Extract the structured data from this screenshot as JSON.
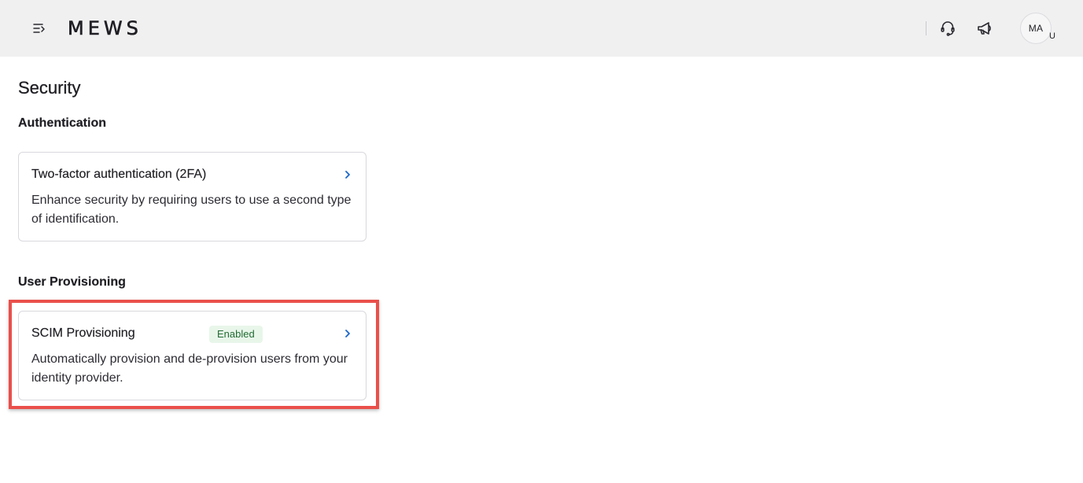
{
  "header": {
    "logo_text": "MEWS",
    "menu_icon": "menu-collapse-icon",
    "support_icon": "headset-icon",
    "announcements_icon": "megaphone-icon",
    "avatar": {
      "initials": "MA",
      "badge": "U"
    }
  },
  "page": {
    "title": "Security"
  },
  "sections": [
    {
      "title": "Authentication",
      "cards": [
        {
          "title": "Two-factor authentication (2FA)",
          "description": "Enhance security by requiring users to use a second type of identification.",
          "chevron_icon": "chevron-right-icon"
        }
      ]
    },
    {
      "title": "User Provisioning",
      "cards": [
        {
          "title": "SCIM Provisioning",
          "badge": "Enabled",
          "description": "Automatically provision and de-provision users from your identity provider.",
          "chevron_icon": "chevron-right-icon",
          "highlighted": true
        }
      ]
    }
  ],
  "colors": {
    "header_bg": "#f0f0f1",
    "accent_link": "#1a66c9",
    "badge_bg": "#e8f6ea",
    "badge_text": "#236b33",
    "highlight": "#ea4f4a"
  }
}
